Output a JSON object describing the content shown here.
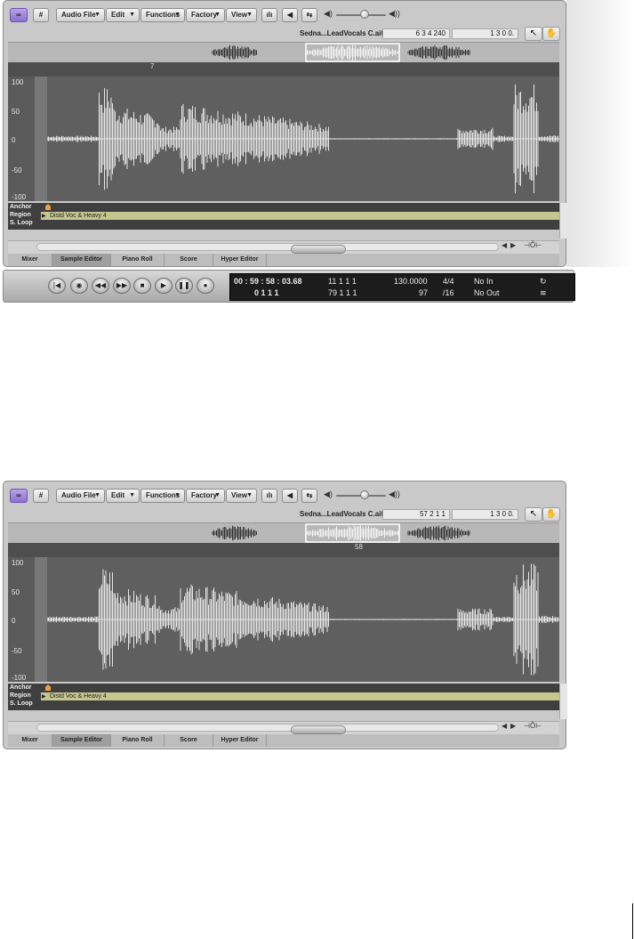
{
  "screens": [
    {
      "toolbar": {
        "link_glyph": "∞",
        "sharp_glyph": "#",
        "menus": [
          "Audio File",
          "Edit",
          "Functions",
          "Factory",
          "View"
        ],
        "catch_glyph": "⇆",
        "vol_lo": "◀)",
        "vol_hi": "◀))"
      },
      "file_label": "Sedna...LeadVocals C.aif",
      "position": "6   3   4  240",
      "length": "1   3   0    0.",
      "tool_pointer": "↖",
      "tool_hand": "✋",
      "ruler_label": "7",
      "y_labels": [
        "100",
        "50",
        "0",
        "-50",
        "-100"
      ],
      "lanes": {
        "anchor": "Anchor",
        "region": "Region",
        "loop": "S. Loop"
      },
      "region_name": "Distd Voc & Heavy 4",
      "tabs": [
        "Mixer",
        "Sample Editor",
        "Piano Roll",
        "Score",
        "Hyper Editor"
      ],
      "active_tab": "Sample Editor",
      "transport": {
        "buttons": [
          "go-to-start",
          "play-from-selection",
          "rewind",
          "fast-forward",
          "stop",
          "play",
          "pause",
          "record"
        ],
        "glyphs": [
          "|◀",
          "◉",
          "◀◀",
          "▶▶",
          "■",
          "▶",
          "❚❚",
          "●"
        ],
        "smpte": "00 : 59 : 58 : 03.68",
        "bars": "0     1     1     1",
        "pos1": "11    1    1    1",
        "pos2": "79    1    1    1",
        "tempo": "130.0000",
        "tempo2": "97",
        "sig": "4/4",
        "div": "/16",
        "in": "No In",
        "out": "No Out",
        "cycle": "↻",
        "replace": "≋"
      }
    },
    {
      "toolbar": {
        "link_glyph": "∞",
        "sharp_glyph": "#",
        "menus": [
          "Audio File",
          "Edit",
          "Functions",
          "Factory",
          "View"
        ],
        "catch_glyph": "⇆",
        "vol_lo": "◀)",
        "vol_hi": "◀))"
      },
      "file_label": "Sedna...LeadVocals C.aif",
      "position": "57   2   1    1",
      "length": "1   3   0    0.",
      "tool_pointer": "↖",
      "tool_hand": "✋",
      "ruler_label": "58",
      "y_labels": [
        "100",
        "50",
        "0",
        "-50",
        "-100"
      ],
      "lanes": {
        "anchor": "Anchor",
        "region": "Region",
        "loop": "S. Loop"
      },
      "region_name": "Distd Voc & Heavy 4",
      "tabs": [
        "Mixer",
        "Sample Editor",
        "Piano Roll",
        "Score",
        "Hyper Editor"
      ],
      "active_tab": "Sample Editor"
    }
  ],
  "colors": {
    "waveform": "#e6e6e6",
    "wave_bg": "#5f5f5f",
    "region": "#c6c690",
    "link_button": "#9b82d8",
    "anchor": "#f0a040"
  }
}
